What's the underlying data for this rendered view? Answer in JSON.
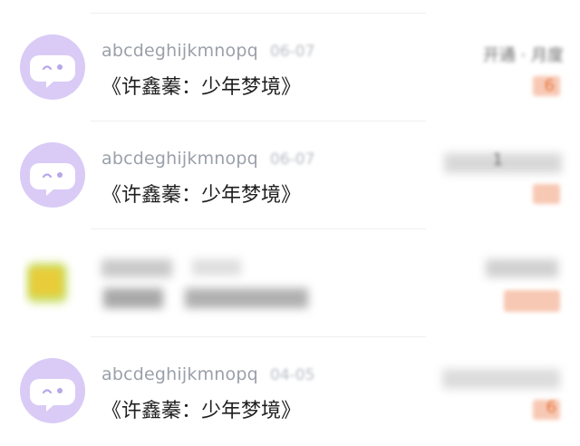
{
  "conversations": [
    {
      "name": "abcdeghijkmnopq",
      "date": "06-07",
      "title": "《许鑫蓁：少年梦境》",
      "right_label": "开通 · 月度",
      "badge": "6",
      "avatar_icon": "chat-bubble-face-icon",
      "avatar_color": "#d9cbf6"
    },
    {
      "name": "abcdeghijkmnopq",
      "date": "06-07",
      "title": "《许鑫蓁：少年梦境》",
      "right_label": "1",
      "badge": "",
      "avatar_icon": "chat-bubble-face-icon",
      "avatar_color": "#d9cbf6"
    },
    {
      "name": "",
      "date": "",
      "title": "",
      "right_label": "",
      "badge": "",
      "avatar_icon": "blurred-photo-avatar",
      "avatar_color": "#c8d86a"
    },
    {
      "name": "abcdeghijkmnopq",
      "date": "04-05",
      "title": "《许鑫蓁：少年梦境》",
      "right_label": "",
      "badge": "6",
      "avatar_icon": "chat-bubble-face-icon",
      "avatar_color": "#d9cbf6"
    }
  ]
}
